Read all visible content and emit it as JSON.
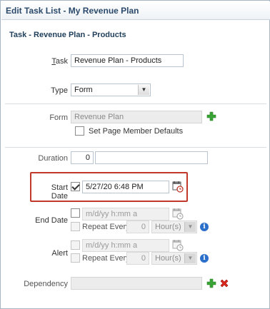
{
  "window": {
    "title": "Edit Task List - My Revenue Plan"
  },
  "section_title": "Task - Revenue Plan - Products",
  "task": {
    "label": "Task",
    "value": "Revenue Plan - Products"
  },
  "type": {
    "label": "Type",
    "value": "Form"
  },
  "form": {
    "label": "Form",
    "value": "Revenue Plan",
    "set_defaults_label": "Set Page Member Defaults",
    "set_defaults_checked": false
  },
  "duration": {
    "label": "Duration",
    "value": "0",
    "unit_value": ""
  },
  "start_date": {
    "label": "Start Date",
    "checked": true,
    "value": "5/27/20 6:48 PM"
  },
  "end_date": {
    "label": "End Date",
    "checked": false,
    "placeholder": "m/d/yy h:mm a",
    "repeat_label": "Repeat Every",
    "repeat_value": "0",
    "repeat_unit": "Hour(s)"
  },
  "alert": {
    "label": "Alert",
    "checked": false,
    "placeholder": "m/d/yy h:mm a",
    "repeat_label": "Repeat Every",
    "repeat_value": "0",
    "repeat_unit": "Hour(s)"
  },
  "dependency": {
    "label": "Dependency",
    "value": ""
  },
  "colors": {
    "accent": "#2b4a6b",
    "highlight": "#c0392b",
    "add": "#3aa335",
    "delete": "#d9251c"
  }
}
